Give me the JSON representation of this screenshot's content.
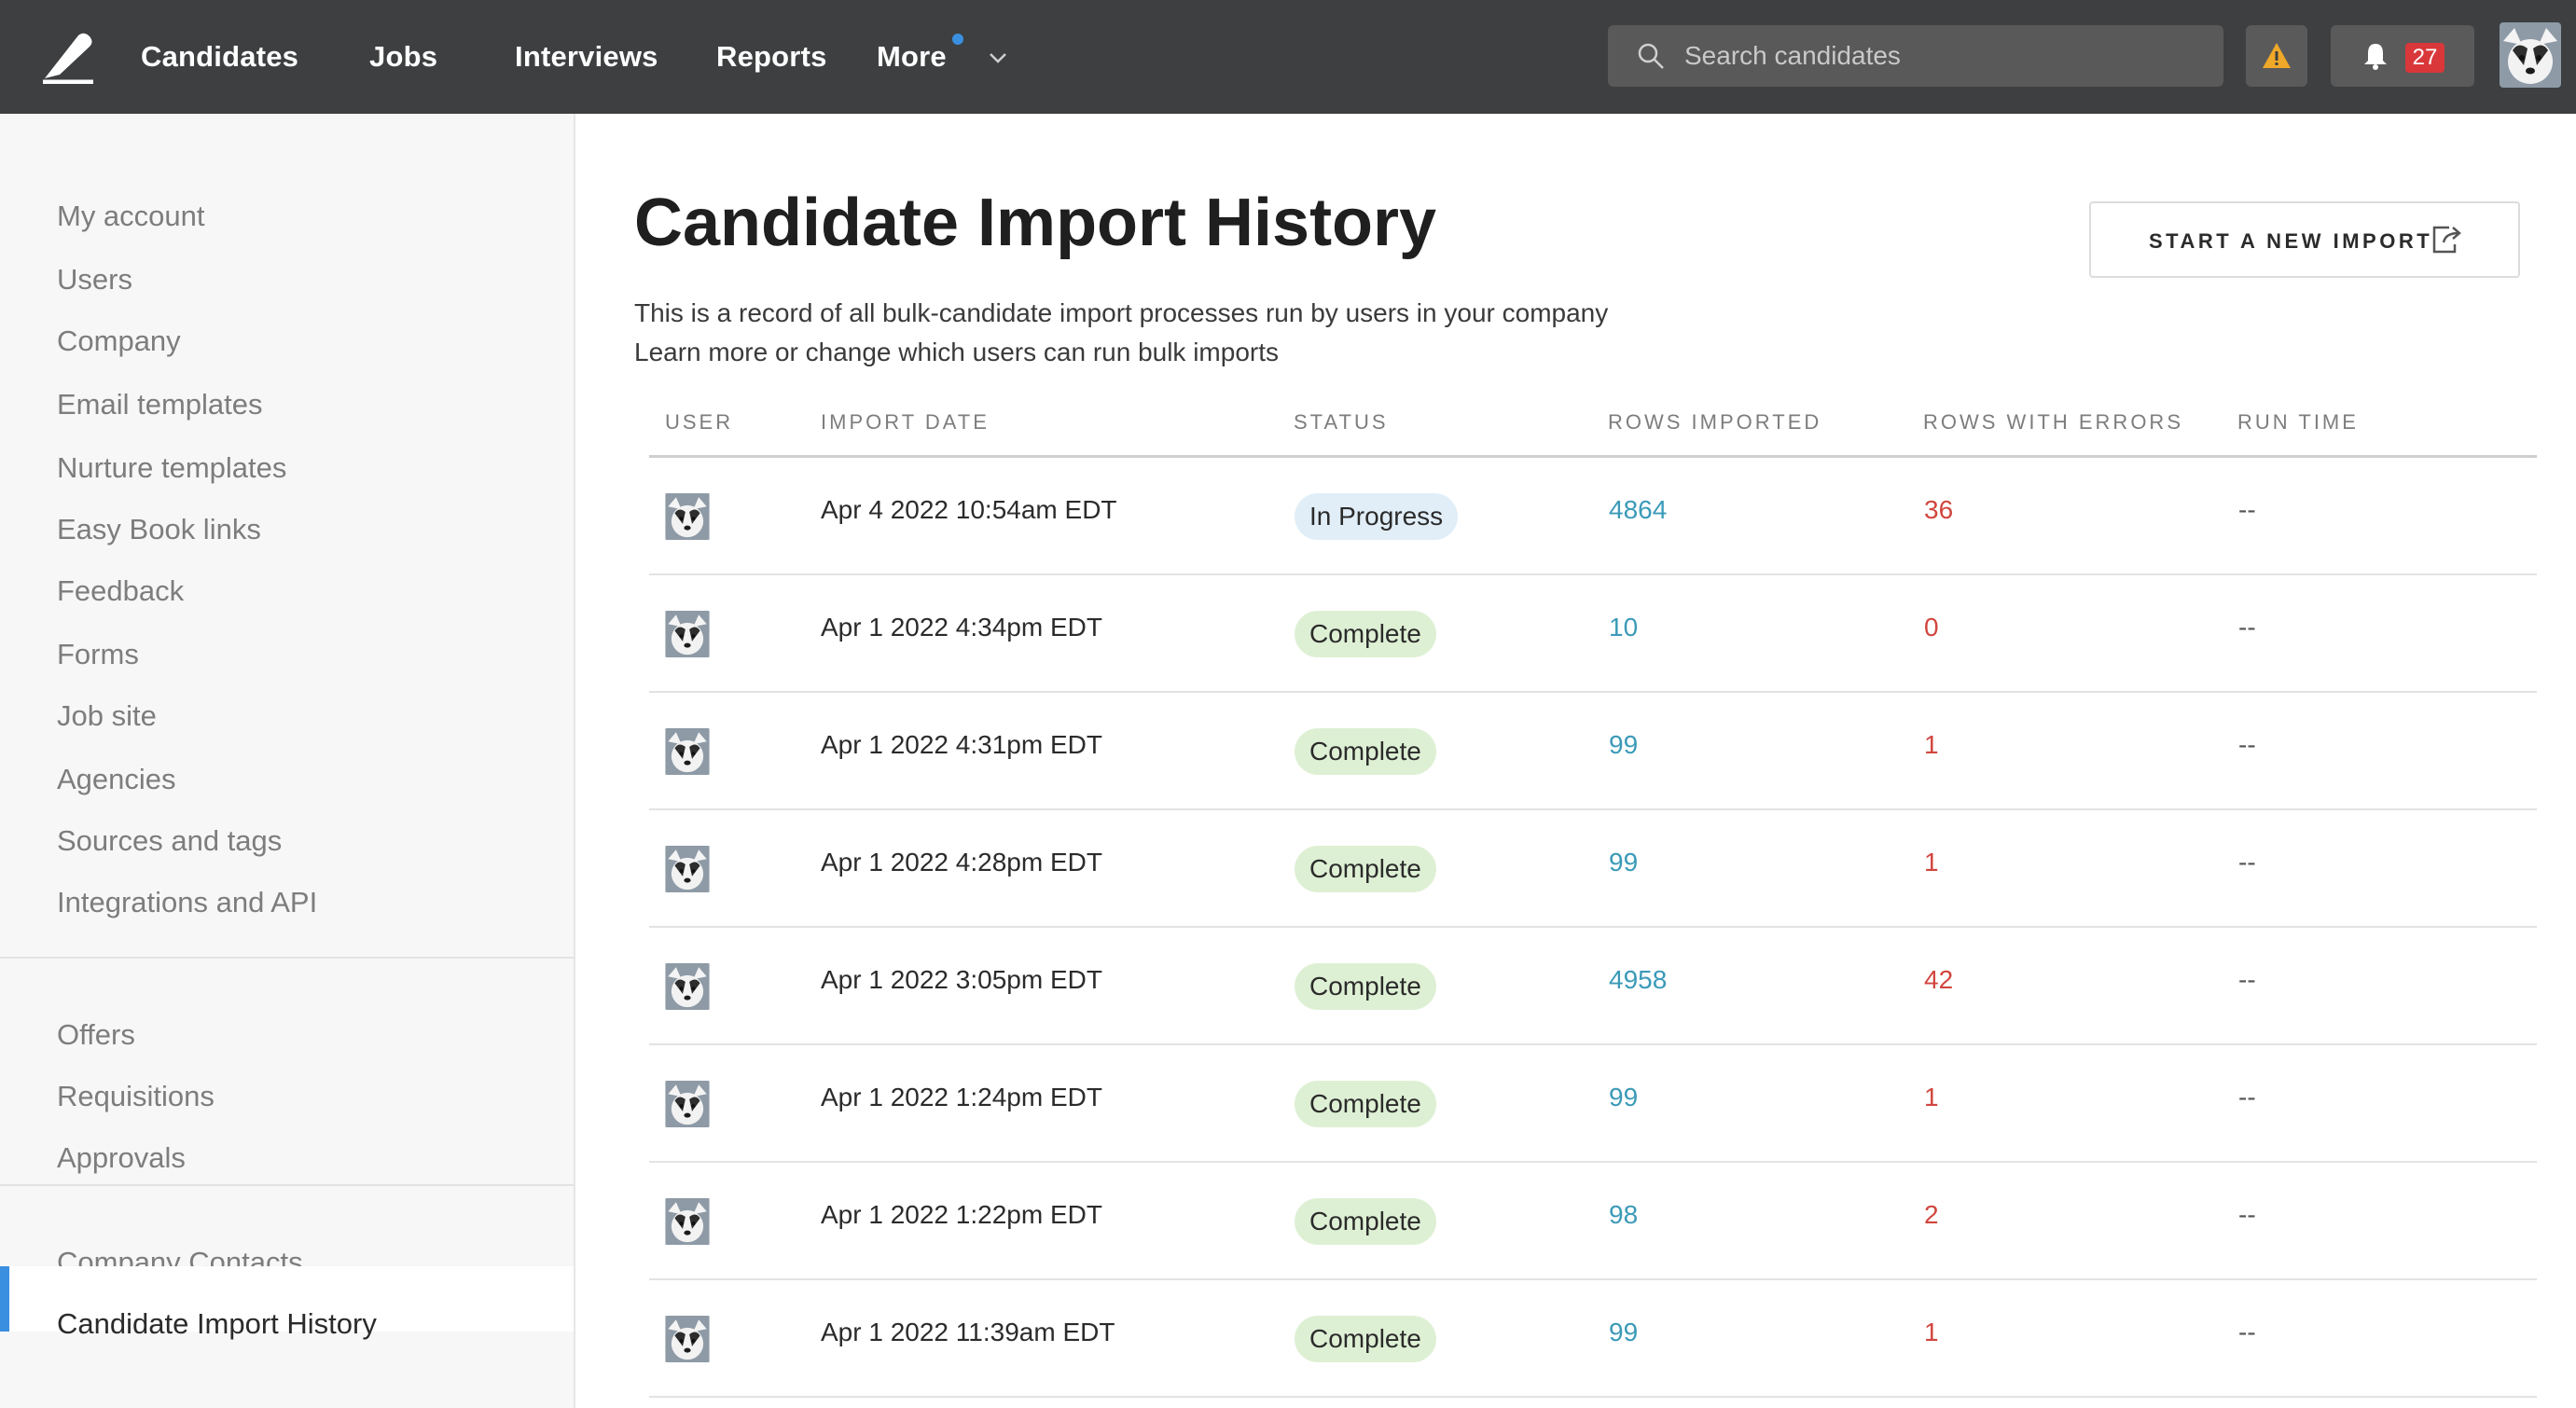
{
  "nav": {
    "items": [
      "Candidates",
      "Jobs",
      "Interviews",
      "Reports",
      "More"
    ],
    "search_placeholder": "Search candidates",
    "notification_count": "27"
  },
  "sidebar": {
    "group1": [
      "My account",
      "Users",
      "Company",
      "Email templates",
      "Nurture templates",
      "Easy Book links",
      "Feedback",
      "Forms",
      "Job site",
      "Agencies",
      "Sources and tags",
      "Integrations and API"
    ],
    "group2": [
      "Offers",
      "Requisitions",
      "Approvals"
    ],
    "group3": [
      "Company Contacts",
      "Candidate Import History"
    ],
    "active": "Candidate Import History"
  },
  "main": {
    "title": "Candidate Import History",
    "subtitle_line1": "This is a record of all bulk-candidate import processes run by users in your company",
    "subtitle_line2": "Learn more or change which users can run bulk imports",
    "new_import_label": "START A NEW IMPORT"
  },
  "table": {
    "headers": [
      "USER",
      "IMPORT DATE",
      "STATUS",
      "ROWS IMPORTED",
      "ROWS WITH ERRORS",
      "RUN TIME"
    ],
    "rows": [
      {
        "date": "Apr 4 2022 10:54am EDT",
        "status": "In Progress",
        "imported": "4864",
        "errors": "36",
        "run_time": "--"
      },
      {
        "date": "Apr 1 2022 4:34pm EDT",
        "status": "Complete",
        "imported": "10",
        "errors": "0",
        "run_time": "--"
      },
      {
        "date": "Apr 1 2022 4:31pm EDT",
        "status": "Complete",
        "imported": "99",
        "errors": "1",
        "run_time": "--"
      },
      {
        "date": "Apr 1 2022 4:28pm EDT",
        "status": "Complete",
        "imported": "99",
        "errors": "1",
        "run_time": "--"
      },
      {
        "date": "Apr 1 2022 3:05pm EDT",
        "status": "Complete",
        "imported": "4958",
        "errors": "42",
        "run_time": "--"
      },
      {
        "date": "Apr 1 2022 1:24pm EDT",
        "status": "Complete",
        "imported": "99",
        "errors": "1",
        "run_time": "--"
      },
      {
        "date": "Apr 1 2022 1:22pm EDT",
        "status": "Complete",
        "imported": "98",
        "errors": "2",
        "run_time": "--"
      },
      {
        "date": "Apr 1 2022 11:39am EDT",
        "status": "Complete",
        "imported": "99",
        "errors": "1",
        "run_time": "--"
      }
    ]
  },
  "colors": {
    "topbar": "#3d3f40",
    "accent": "#3b8fe0",
    "imported": "#3b9ab8",
    "errors": "#d1463e",
    "complete_bg": "#def0d4",
    "progress_bg": "#e1eef7"
  }
}
